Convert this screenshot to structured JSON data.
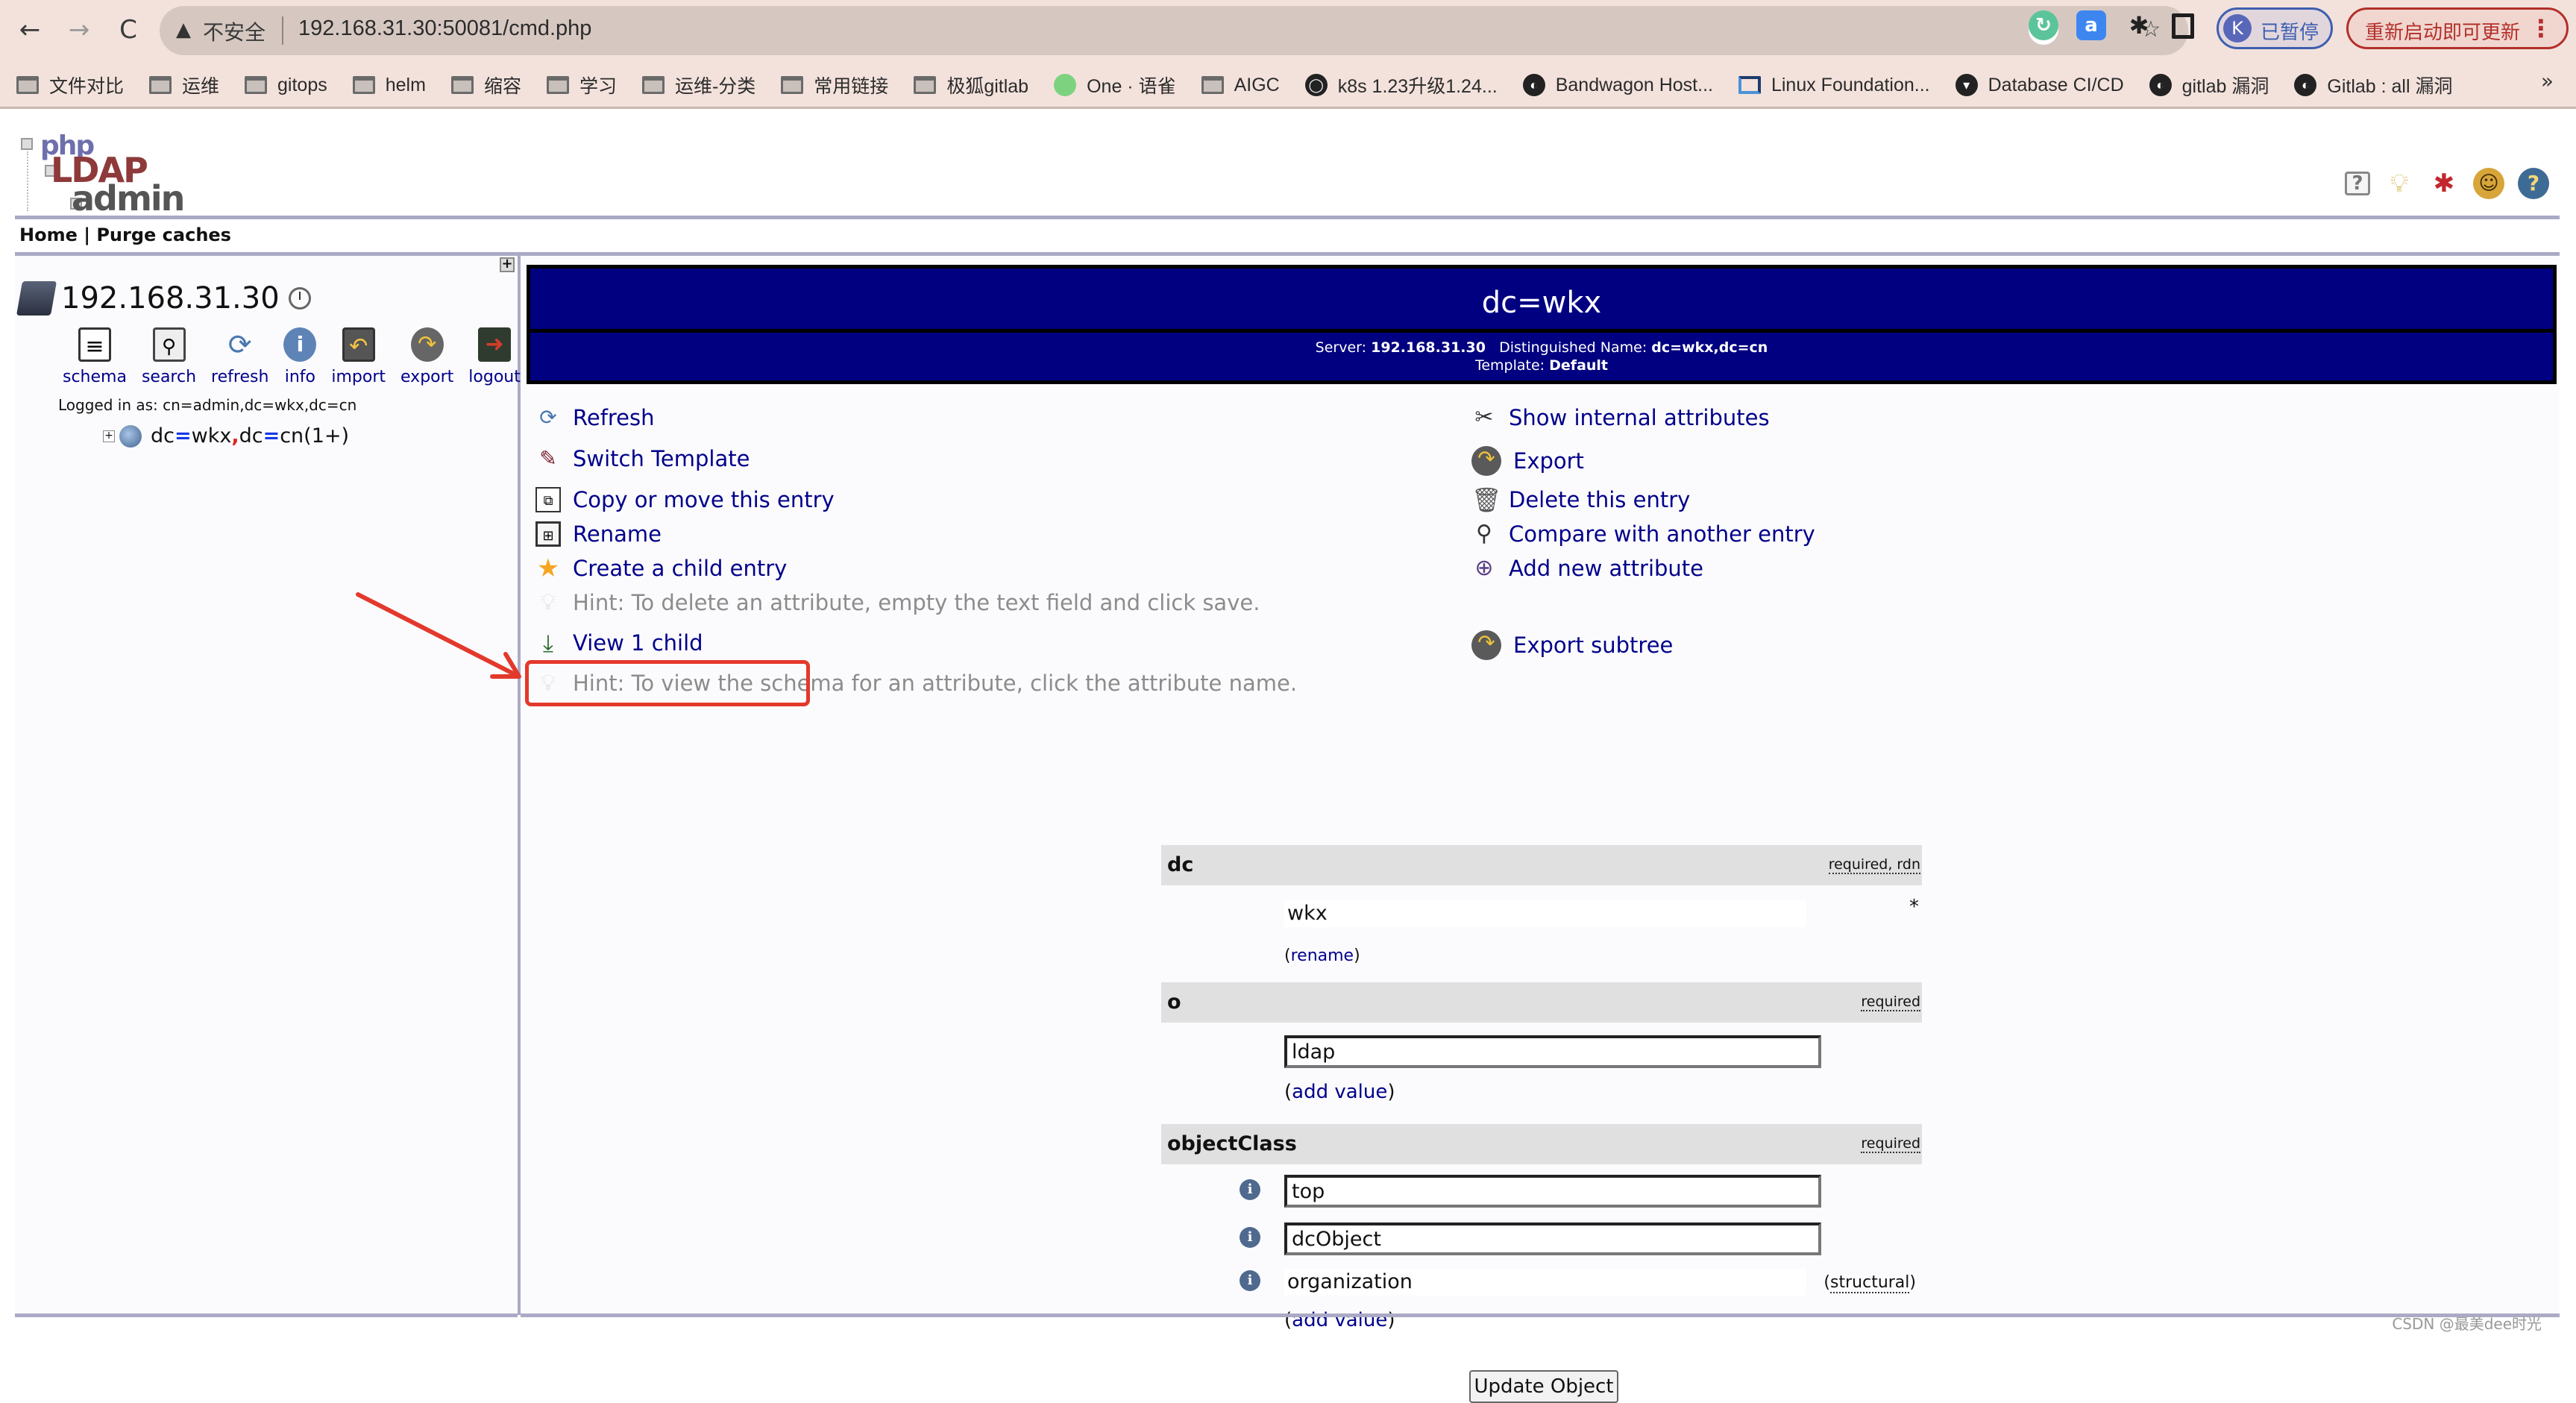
{
  "browser": {
    "nav": {
      "back": "←",
      "forward": "→",
      "reload": "C"
    },
    "security_label": "不安全",
    "url": "192.168.31.30:50081/cmd.php",
    "profile": {
      "initial": "K",
      "label": "已暂停"
    },
    "update_label": "重新启动即可更新",
    "bookmarks": [
      {
        "label": "文件对比",
        "icon": "folder-icon"
      },
      {
        "label": "运维",
        "icon": "folder-icon"
      },
      {
        "label": "gitops",
        "icon": "folder-icon"
      },
      {
        "label": "helm",
        "icon": "folder-icon"
      },
      {
        "label": "缩容",
        "icon": "folder-icon"
      },
      {
        "label": "学习",
        "icon": "folder-icon"
      },
      {
        "label": "运维-分类",
        "icon": "folder-icon"
      },
      {
        "label": "常用链接",
        "icon": "folder-icon"
      },
      {
        "label": "极狐gitlab",
        "icon": "folder-icon"
      },
      {
        "label": "One · 语雀",
        "icon": "yuque-icon"
      },
      {
        "label": "AIGC",
        "icon": "folder-icon"
      },
      {
        "label": "k8s 1.23升级1.24...",
        "icon": "github-icon"
      },
      {
        "label": "Bandwagon Host...",
        "icon": "globe-icon"
      },
      {
        "label": "Linux Foundation...",
        "icon": "linux-foundation-icon"
      },
      {
        "label": "Database CI/CD",
        "icon": "database-cicd-icon"
      },
      {
        "label": "gitlab 漏洞",
        "icon": "globe-icon"
      },
      {
        "label": "Gitlab : all 漏洞",
        "icon": "globe-icon"
      }
    ],
    "bookmarks_more": "»"
  },
  "app": {
    "logo": {
      "php": "php",
      "ldap": "LDAP",
      "admin": "admin"
    },
    "breadcrumb": {
      "home": "Home",
      "separator": " | ",
      "purge": "Purge caches"
    }
  },
  "sidebar": {
    "server_name": "192.168.31.30",
    "tools": [
      {
        "label": "schema",
        "icon": "schema-icon"
      },
      {
        "label": "search",
        "icon": "search-icon"
      },
      {
        "label": "refresh",
        "icon": "refresh-icon"
      },
      {
        "label": "info",
        "icon": "info-icon"
      },
      {
        "label": "import",
        "icon": "import-icon"
      },
      {
        "label": "export",
        "icon": "export-icon"
      },
      {
        "label": "logout",
        "icon": "logout-icon"
      }
    ],
    "logged_in": "Logged in as: cn=admin,dc=wkx,dc=cn",
    "tree": {
      "dc1_key": "dc",
      "dc1_val": "wkx",
      "dc2_key": "dc",
      "dc2_val": "cn",
      "count": " (1+)"
    }
  },
  "entry": {
    "title": "dc=wkx",
    "server_label": "Server:",
    "server": "192.168.31.30",
    "dn_label": "Distinguished Name:",
    "dn": "dc=wkx,dc=cn",
    "template_label": "Template:",
    "template": "Default"
  },
  "actions_left": [
    {
      "label": "Refresh",
      "icon": "refresh-icon"
    },
    {
      "label": "Switch Template",
      "icon": "switch-template-icon"
    },
    {
      "label": "Copy or move this entry",
      "icon": "copy-icon"
    },
    {
      "label": "Rename",
      "icon": "rename-icon"
    },
    {
      "label": "Create a child entry",
      "icon": "star-icon"
    },
    {
      "label": "Hint: To delete an attribute, empty the text field and click save.",
      "icon": "lightbulb-icon"
    },
    {
      "label": "View 1 child",
      "icon": "download-arrow-icon"
    },
    {
      "label": "Hint: To view the schema for an attribute, click the attribute name.",
      "icon": "lightbulb-icon"
    }
  ],
  "actions_right": [
    {
      "label": "Show internal attributes",
      "icon": "tools-icon"
    },
    {
      "label": "Export",
      "icon": "export-icon"
    },
    {
      "label": "Delete this entry",
      "icon": "trash-icon"
    },
    {
      "label": "Compare with another entry",
      "icon": "compare-icon"
    },
    {
      "label": "Add new attribute",
      "icon": "add-attribute-icon"
    },
    {
      "label": "Export subtree",
      "icon": "export-icon"
    }
  ],
  "attributes": {
    "dc": {
      "name": "dc",
      "flags": "required, rdn",
      "value": "wkx",
      "marker": "*",
      "link": "rename"
    },
    "o": {
      "name": "o",
      "flags": "required",
      "value": "ldap",
      "link": "add value"
    },
    "objectClass": {
      "name": "objectClass",
      "flags": "required",
      "values": [
        "top",
        "dcObject"
      ],
      "readonly_value": "organization",
      "readonly_note": "structural",
      "link": "add value"
    }
  },
  "update_button": "Update Object",
  "watermark": "CSDN @最美dee时光",
  "colors": {
    "header_bg": "#000080",
    "link": "#00008b",
    "annotation": "#e3392c",
    "divider": "#aaaac6"
  }
}
